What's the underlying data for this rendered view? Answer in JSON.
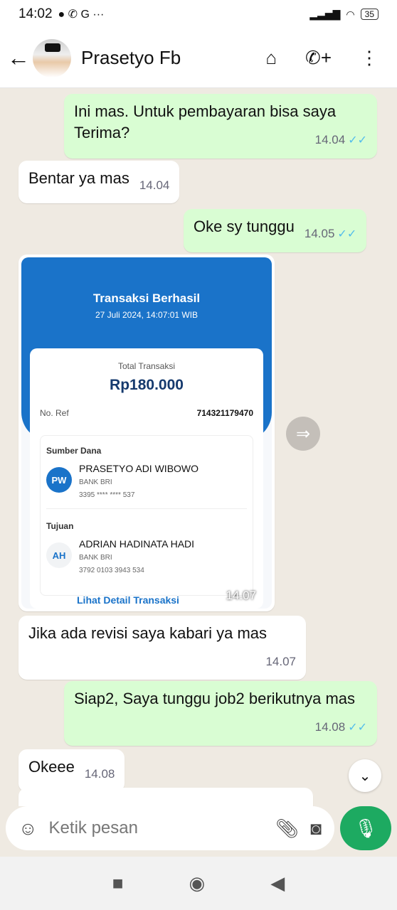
{
  "status": {
    "time": "14:02",
    "battery": "35"
  },
  "header": {
    "contact": "Prasetyo Fb"
  },
  "messages": [
    {
      "dir": "out",
      "text": "Ini mas. Untuk pembayaran bisa saya Terima?",
      "time": "14.04"
    },
    {
      "dir": "in",
      "text": "Bentar ya mas",
      "time": "14.04"
    },
    {
      "dir": "out",
      "text": "Oke sy tunggu",
      "time": "14.05"
    },
    {
      "dir": "in",
      "text": "Jika ada revisi saya kabari ya mas",
      "time": "14.07"
    },
    {
      "dir": "out",
      "text": "Siap2, Saya tunggu job2 berikutnya mas",
      "time": "14.08"
    },
    {
      "dir": "in",
      "text": "Okeee",
      "time": "14.08"
    }
  ],
  "receipt": {
    "title": "Transaksi Berhasil",
    "datetime": "27 Juli 2024, 14:07:01 WIB",
    "total_label": "Total Transaksi",
    "amount": "Rp180.000",
    "ref_label": "No. Ref",
    "ref": "714321179470",
    "source_label": "Sumber Dana",
    "source_initials": "PW",
    "source_name": "PRASETYO ADI WIBOWO",
    "source_bank": "BANK BRI",
    "source_acct": "3395 **** **** 537",
    "dest_label": "Tujuan",
    "dest_initials": "AH",
    "dest_name": "ADRIAN HADINATA HADI",
    "dest_bank": "BANK BRI",
    "dest_acct": "3792 0103 3943 534",
    "detail_link": "Lihat Detail Transaksi",
    "time": "14.07"
  },
  "input": {
    "placeholder": "Ketik pesan"
  }
}
